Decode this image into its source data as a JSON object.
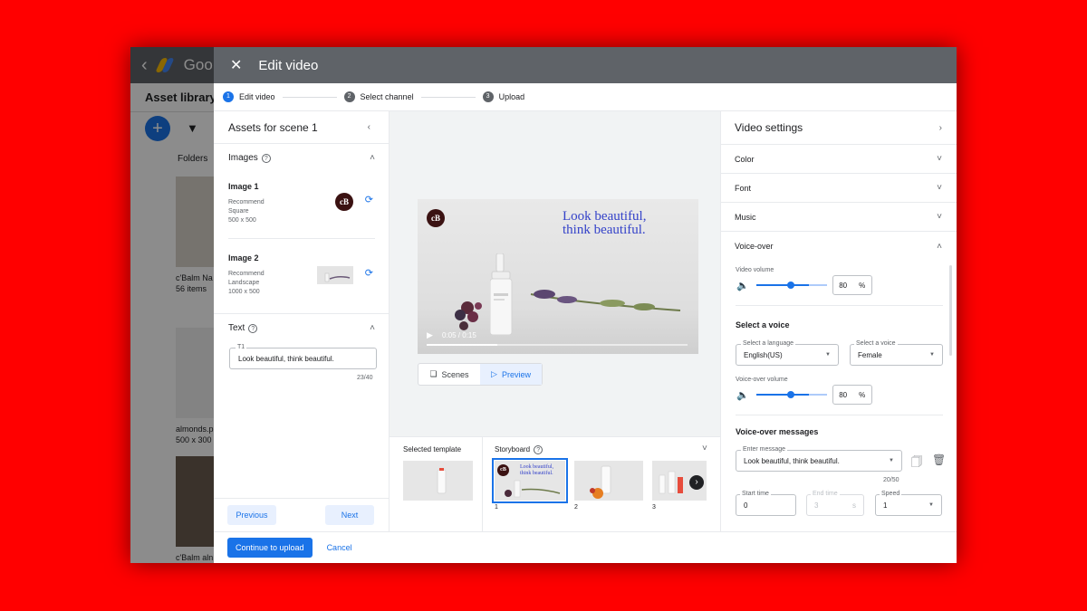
{
  "background_app": {
    "brand": "Goo",
    "subtitle": "Asset library",
    "add_icon": "plus-icon",
    "filter_icon": "filter-icon",
    "folders_label": "Folders",
    "folder1_name": "c'Balm Na",
    "folder1_count": "56 items",
    "file2_name": "almonds.p",
    "file2_size": "500 x 300",
    "file3_name": "c'Balm aln"
  },
  "modal": {
    "title": "Edit video",
    "close_icon": "close-icon",
    "steps": [
      {
        "num": "1",
        "label": "Edit video"
      },
      {
        "num": "2",
        "label": "Select channel"
      },
      {
        "num": "3",
        "label": "Upload"
      }
    ]
  },
  "left_panel": {
    "title": "Assets for scene 1",
    "images_heading": "Images",
    "image1": {
      "name": "Image 1",
      "meta1": "Recommend",
      "meta2": "Square",
      "meta3": "500 x 500"
    },
    "image2": {
      "name": "Image 2",
      "meta1": "Recommend",
      "meta2": "Landscape",
      "meta3": "1000 x 500"
    },
    "text_heading": "Text",
    "text_field_label": "T1",
    "text_field_value": "Look beautiful, think beautiful.",
    "text_counter": "23/40",
    "previous_label": "Previous",
    "next_label": "Next"
  },
  "preview": {
    "logo_text": "cB",
    "headline_line1": "Look beautiful,",
    "headline_line2": "think beautiful.",
    "time": "0:05 / 0:15",
    "progress": 0.27,
    "scenes_label": "Scenes",
    "preview_label": "Preview"
  },
  "strip": {
    "selected_template_label": "Selected template",
    "storyboard_label": "Storyboard",
    "frames": [
      {
        "num": "1",
        "caption": "Look beautiful, think beautiful."
      },
      {
        "num": "2"
      },
      {
        "num": "3"
      }
    ]
  },
  "right_panel": {
    "title": "Video settings",
    "color_label": "Color",
    "font_label": "Font",
    "music_label": "Music",
    "voiceover_label": "Voice-over",
    "video_volume_label": "Video volume",
    "video_volume_value": "80",
    "video_volume_level": 0.8,
    "pct": "%",
    "select_voice_label": "Select a voice",
    "language_label": "Select a language",
    "language_value": "English(US)",
    "voice_label": "Select a voice",
    "voice_value": "Female",
    "voiceover_volume_label": "Voice-over volume",
    "voiceover_volume_value": "80",
    "voiceover_volume_level": 0.8,
    "messages_label": "Voice-over messages",
    "enter_message_label": "Enter message",
    "message_value": "Look beautiful, think beautiful.",
    "message_counter": "20/50",
    "start_time_label": "Start time",
    "start_time_value": "0",
    "end_time_label": "End time",
    "end_time_value": "3",
    "end_time_unit": "s",
    "speed_label": "Speed",
    "speed_value": "1"
  },
  "footer": {
    "continue_label": "Continue to upload",
    "cancel_label": "Cancel"
  }
}
